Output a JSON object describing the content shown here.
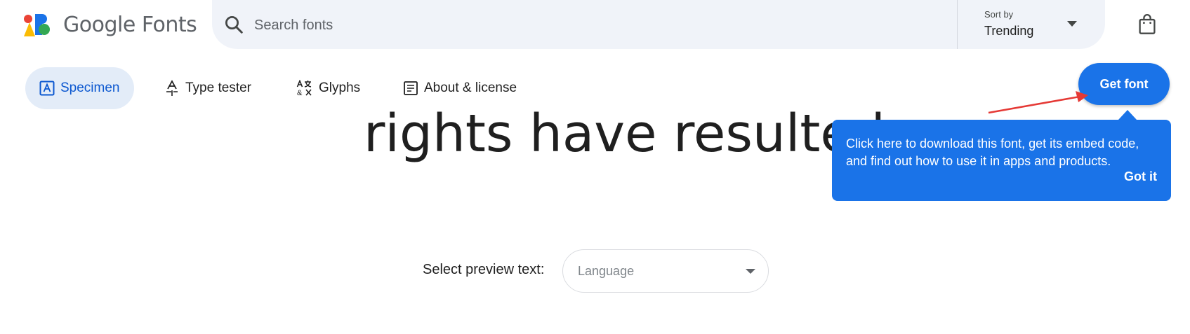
{
  "header": {
    "brand": "Google Fonts",
    "search": {
      "placeholder": "Search fonts",
      "value": ""
    },
    "sort": {
      "label": "Sort by",
      "value": "Trending"
    }
  },
  "tabs": [
    {
      "label": "Specimen",
      "icon": "specimen-icon",
      "selected": true
    },
    {
      "label": "Type tester",
      "icon": "type-tester-icon",
      "selected": false
    },
    {
      "label": "Glyphs",
      "icon": "glyphs-icon",
      "selected": false
    },
    {
      "label": "About & license",
      "icon": "about-icon",
      "selected": false
    }
  ],
  "get_font_label": "Get font",
  "preview": {
    "text": "rights have resulted"
  },
  "tooltip": {
    "line1": "Click here to download this font, get its embed code,",
    "line2": "and find out how to use it in apps and products.",
    "dismiss": "Got it"
  },
  "preview_select": {
    "label": "Select preview text:",
    "placeholder": "Language"
  },
  "colors": {
    "accent": "#1a73e8",
    "search_bg": "#f0f3f9",
    "selected_tab_bg": "#e3ecf8",
    "annotation": "#e53935"
  }
}
